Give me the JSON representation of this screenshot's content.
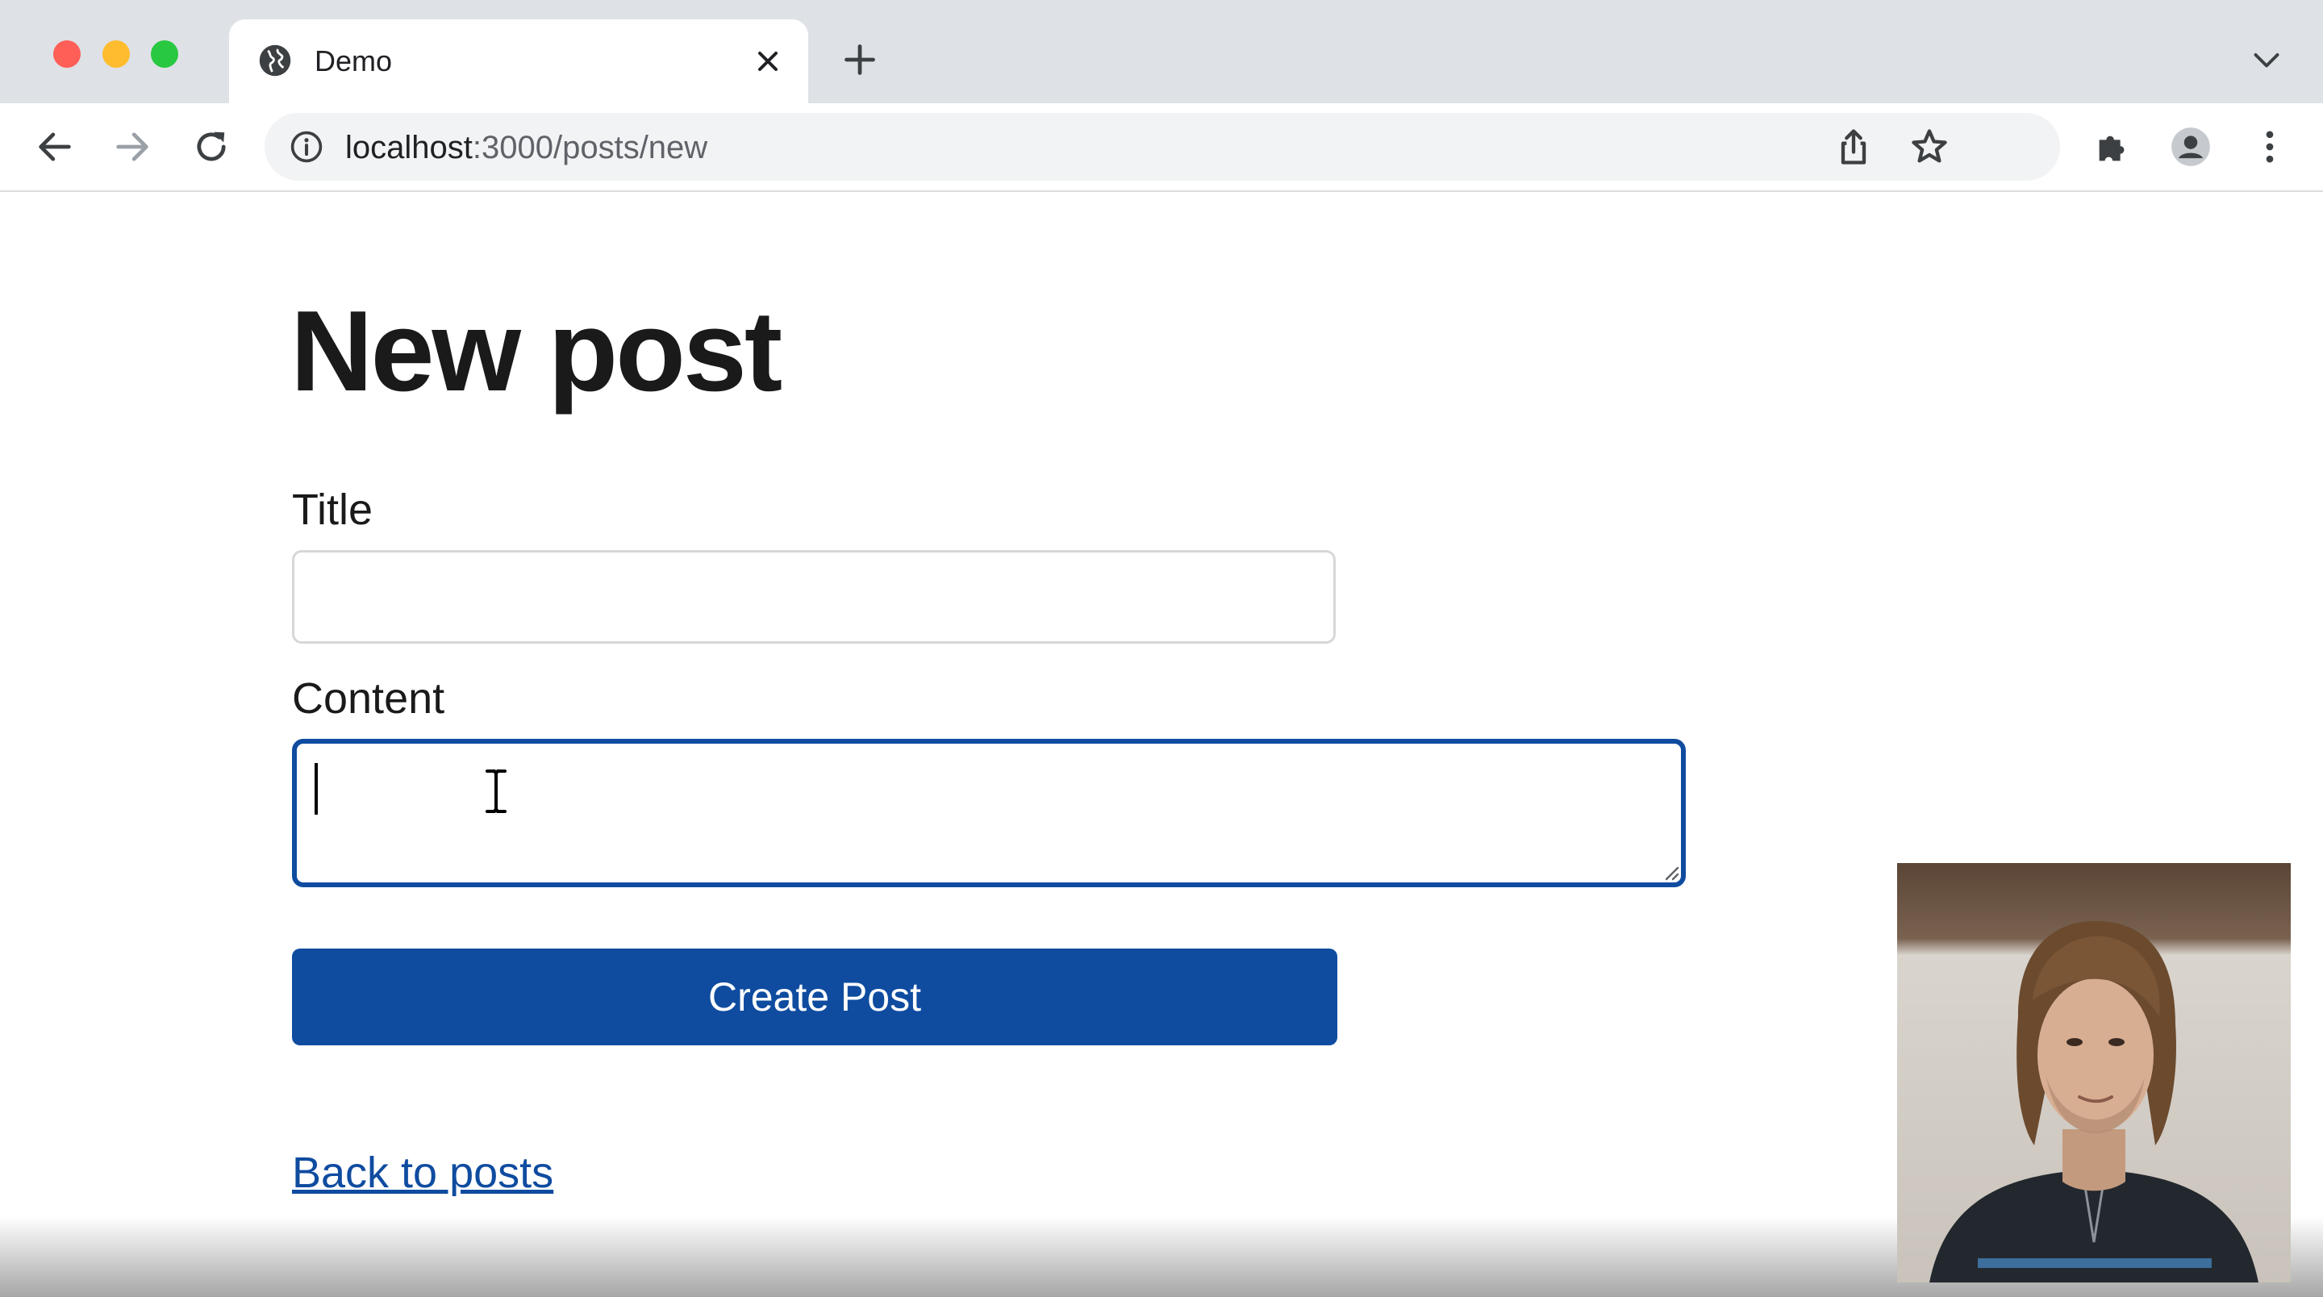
{
  "browser": {
    "tab_title": "Demo",
    "url_host": "localhost",
    "url_path": ":3000/posts/new",
    "icons": {
      "favicon": "globe-icon",
      "tab_close": "close-icon",
      "new_tab": "plus-icon",
      "tab_search": "chevron-down-icon",
      "back": "arrow-left-icon",
      "forward": "arrow-right-icon",
      "reload": "reload-icon",
      "site_info": "info-icon",
      "share": "share-icon",
      "bookmark": "star-icon",
      "extensions": "puzzle-icon",
      "profile": "avatar-icon",
      "menu": "kebab-menu-icon"
    }
  },
  "page": {
    "title": "New post",
    "form": {
      "title_label": "Title",
      "title_value": "",
      "content_label": "Content",
      "content_value": "",
      "submit_label": "Create Post"
    },
    "back_link": "Back to posts"
  },
  "colors": {
    "accent": "#0f4ca0",
    "tabstrip": "#dee1e6",
    "omnibox": "#f1f3f4",
    "traffic_red": "#ff5f57",
    "traffic_yellow": "#febc2e",
    "traffic_green": "#28c840"
  }
}
